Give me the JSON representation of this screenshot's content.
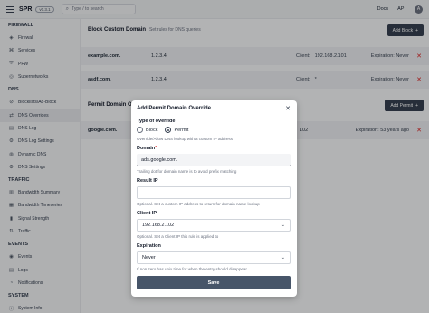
{
  "app": {
    "name": "SPR",
    "version": "v0.3.1"
  },
  "search": {
    "placeholder": "Type / to search"
  },
  "topbar": {
    "docs": "Docs",
    "api": "API",
    "avatar": "A"
  },
  "sidebar": [
    {
      "section": "FIREWALL",
      "items": [
        {
          "label": "Firewall",
          "icon": "flame-icon",
          "glyph": "◈"
        },
        {
          "label": "Services",
          "icon": "services-icon",
          "glyph": "⌘"
        },
        {
          "label": "PFW",
          "icon": "shield-icon",
          "glyph": "⛨"
        },
        {
          "label": "Supernetworks",
          "icon": "network-icon",
          "glyph": "◎"
        }
      ]
    },
    {
      "section": "DNS",
      "items": [
        {
          "label": "Blocklists/Ad-Block",
          "icon": "block-icon",
          "glyph": "⊘"
        },
        {
          "label": "DNS Overrides",
          "icon": "override-icon",
          "glyph": "⇄",
          "active": true
        },
        {
          "label": "DNS Log",
          "icon": "log-icon",
          "glyph": "▤"
        },
        {
          "label": "DNS Log Settings",
          "icon": "settings-icon",
          "glyph": "⚙"
        },
        {
          "label": "Dynamic DNS",
          "icon": "globe-icon",
          "glyph": "◍"
        },
        {
          "label": "DNS Settings",
          "icon": "settings-icon",
          "glyph": "⚙"
        }
      ]
    },
    {
      "section": "TRAFFIC",
      "items": [
        {
          "label": "Bandwidth Summary",
          "icon": "chart-icon",
          "glyph": "▥"
        },
        {
          "label": "Bandwidth Timeseries",
          "icon": "chart-icon",
          "glyph": "▦"
        },
        {
          "label": "Signal Strength",
          "icon": "signal-icon",
          "glyph": "▮"
        },
        {
          "label": "Traffic",
          "icon": "traffic-icon",
          "glyph": "⇅"
        }
      ]
    },
    {
      "section": "EVENTS",
      "items": [
        {
          "label": "Events",
          "icon": "bell-icon",
          "glyph": "◉"
        },
        {
          "label": "Logs",
          "icon": "log-icon",
          "glyph": "▤"
        },
        {
          "label": "Notifications",
          "icon": "notification-icon",
          "glyph": "◔"
        }
      ]
    },
    {
      "section": "SYSTEM",
      "items": [
        {
          "label": "System Info",
          "icon": "info-icon",
          "glyph": "ⓘ"
        }
      ]
    }
  ],
  "main": {
    "block": {
      "title": "Block Custom Domain",
      "subtitle": "Set rules for DNS queries",
      "add_label": "Add Block"
    },
    "block_rows": [
      {
        "domain": "example.com.",
        "ip": "1.2.3.4",
        "client_label": "Client:",
        "client": "192.168.2.101",
        "expiration_label": "Expiration:",
        "expiration": "Never"
      },
      {
        "domain": "asdf.com.",
        "ip": "1.2.3.4",
        "client_label": "Client:",
        "client": "*",
        "expiration_label": "Expiration:",
        "expiration": "Never"
      }
    ],
    "permit": {
      "title": "Permit Domain Ov",
      "add_label": "Add Permit"
    },
    "permit_rows": [
      {
        "domain": "google.com.",
        "client_suffix": "102",
        "expiration_label": "Expiration:",
        "expiration": "53 years ago"
      }
    ]
  },
  "modal": {
    "title": "Add Permit Domain Override",
    "type_label": "Type of override",
    "type_options": [
      "Block",
      "Permit"
    ],
    "type_selected": "Permit",
    "type_help": "Override/Allow DNS lookup with a custom IP address",
    "domain_label": "Domain",
    "domain_required": "*",
    "domain_value": "ads.google.com.",
    "domain_help": "Trailing dot for domain name is to avoid prefix matching",
    "result_ip_label": "Result IP",
    "result_ip_value": "",
    "result_ip_help": "Optional. Set a custom IP address to return for domain name lookup",
    "client_ip_label": "Client IP",
    "client_ip_value": "192.168.2.102",
    "client_ip_help": "Optional. Set a Client IP this rule is applied to",
    "expiration_label": "Expiration",
    "expiration_value": "Never",
    "expiration_help": "If non zero has unix time for when the entry should disappear",
    "save_label": "Save"
  },
  "colors": {
    "accent": "#374151",
    "save": "#475569",
    "danger": "#dc2626"
  }
}
